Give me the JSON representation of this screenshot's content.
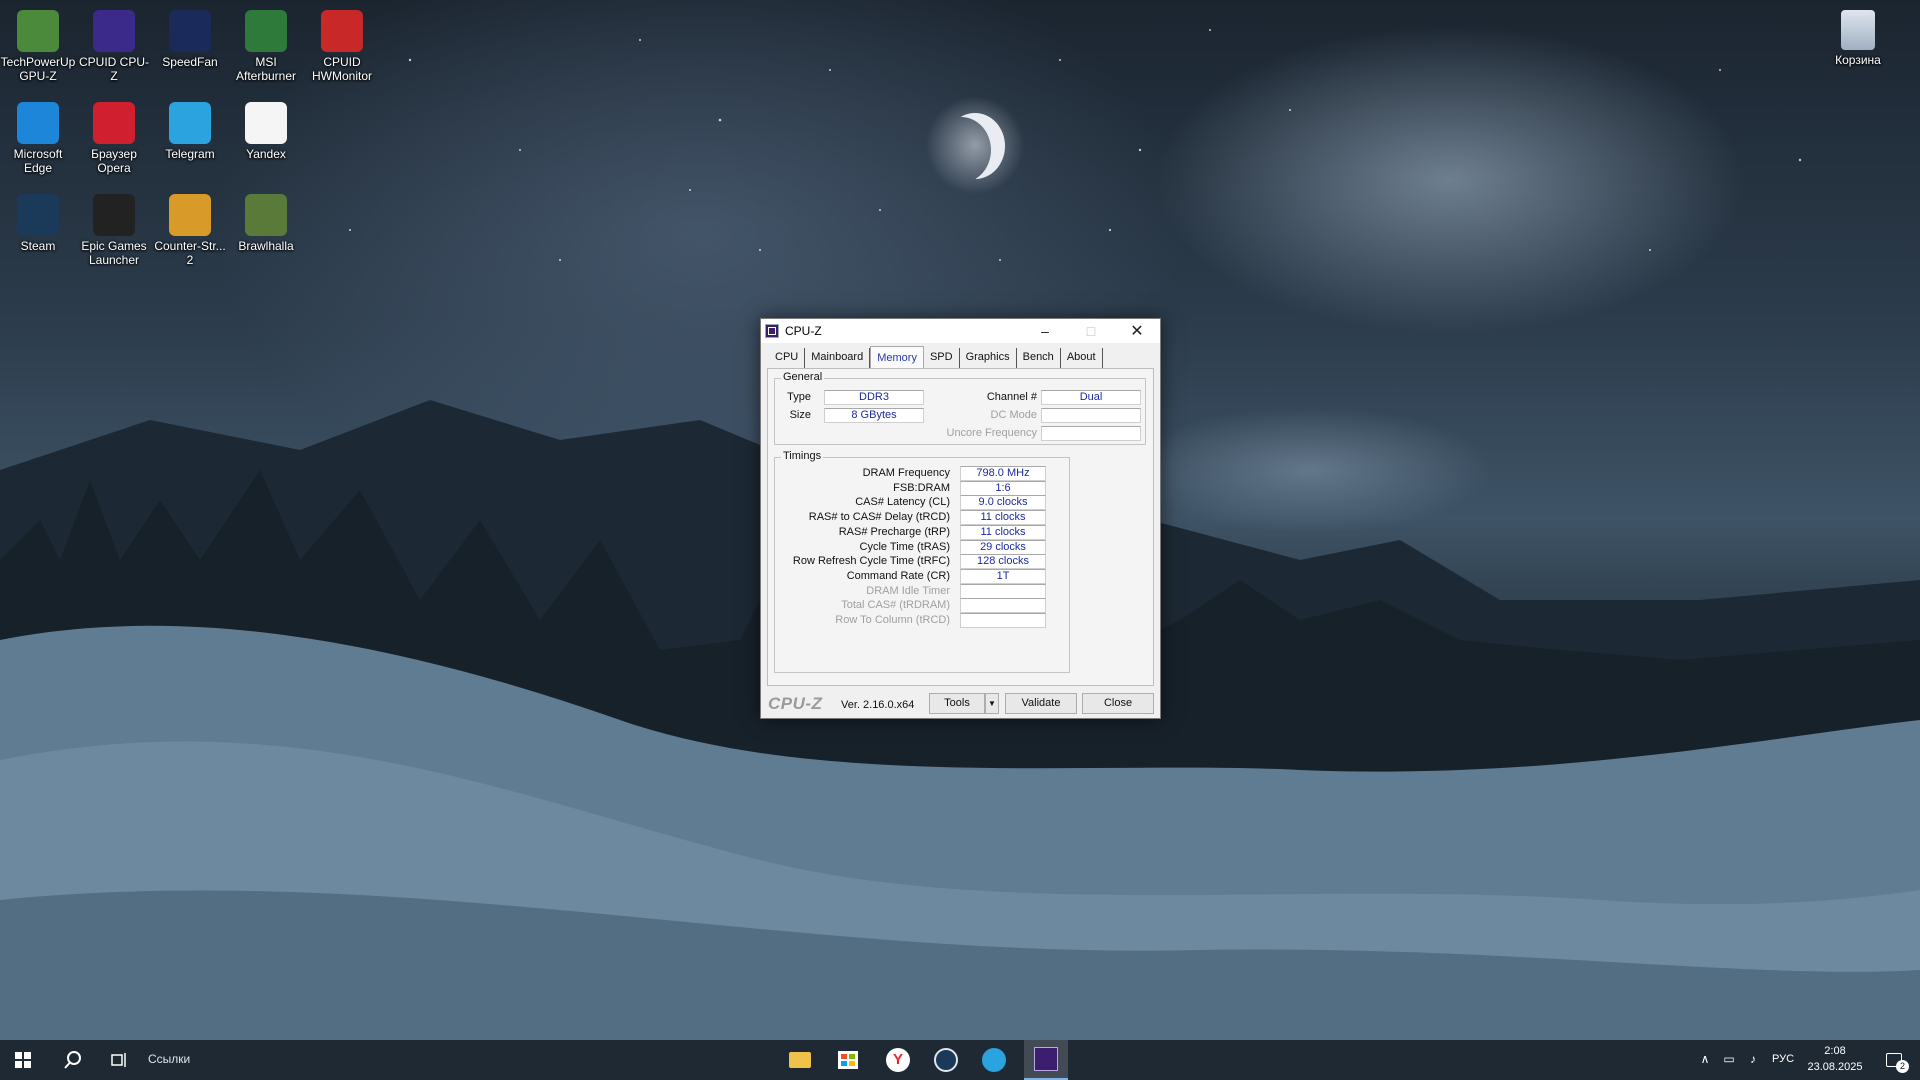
{
  "desktop": {
    "icons": [
      {
        "label": "TechPowerUp GPU-Z",
        "color": "#4a8a3a"
      },
      {
        "label": "CPUID CPU-Z",
        "color": "#3c2a8a"
      },
      {
        "label": "SpeedFan",
        "color": "#1a2a5a"
      },
      {
        "label": "MSI Afterburner",
        "color": "#2e7a3a"
      },
      {
        "label": "CPUID HWMonitor",
        "color": "#c82828"
      },
      {
        "label": "Microsoft Edge",
        "color": "#1e86d8"
      },
      {
        "label": "Браузер Opera",
        "color": "#d01f2f"
      },
      {
        "label": "Telegram",
        "color": "#2aa3df"
      },
      {
        "label": "Yandex",
        "color": "#f5f5f5"
      },
      {
        "label": "Steam",
        "color": "#1b3a5a"
      },
      {
        "label": "Epic Games Launcher",
        "color": "#222222"
      },
      {
        "label": "Counter-Str... 2",
        "color": "#d89a28"
      },
      {
        "label": "Brawlhalla",
        "color": "#5a7a3a"
      }
    ],
    "recycle_bin": {
      "label": "Корзина"
    }
  },
  "window": {
    "title": "CPU-Z",
    "tabs": [
      "CPU",
      "Mainboard",
      "Memory",
      "SPD",
      "Graphics",
      "Bench",
      "About"
    ],
    "active_tab": "Memory",
    "general": {
      "label": "General",
      "type_label": "Type",
      "type_value": "DDR3",
      "size_label": "Size",
      "size_value": "8 GBytes",
      "channel_label": "Channel #",
      "channel_value": "Dual",
      "dc_mode_label": "DC Mode",
      "dc_mode_value": "",
      "uncore_label": "Uncore Frequency",
      "uncore_value": ""
    },
    "timings": {
      "label": "Timings",
      "rows": [
        {
          "label": "DRAM Frequency",
          "value": "798.0 MHz",
          "enabled": true
        },
        {
          "label": "FSB:DRAM",
          "value": "1:6",
          "enabled": true
        },
        {
          "label": "CAS# Latency (CL)",
          "value": "9.0 clocks",
          "enabled": true
        },
        {
          "label": "RAS# to CAS# Delay (tRCD)",
          "value": "11 clocks",
          "enabled": true
        },
        {
          "label": "RAS# Precharge (tRP)",
          "value": "11 clocks",
          "enabled": true
        },
        {
          "label": "Cycle Time (tRAS)",
          "value": "29 clocks",
          "enabled": true
        },
        {
          "label": "Row Refresh Cycle Time (tRFC)",
          "value": "128 clocks",
          "enabled": true
        },
        {
          "label": "Command Rate (CR)",
          "value": "1T",
          "enabled": true
        },
        {
          "label": "DRAM Idle Timer",
          "value": "",
          "enabled": false
        },
        {
          "label": "Total CAS# (tRDRAM)",
          "value": "",
          "enabled": false
        },
        {
          "label": "Row To Column (tRCD)",
          "value": "",
          "enabled": false
        }
      ]
    },
    "footer": {
      "brand": "CPU-Z",
      "version": "Ver. 2.16.0.x64",
      "tools_label": "Tools",
      "validate_label": "Validate",
      "close_label": "Close"
    }
  },
  "taskbar": {
    "links_label": "Ссылки",
    "language": "РУС",
    "time": "2:08",
    "date": "23.08.2025",
    "notification_count": "2"
  }
}
